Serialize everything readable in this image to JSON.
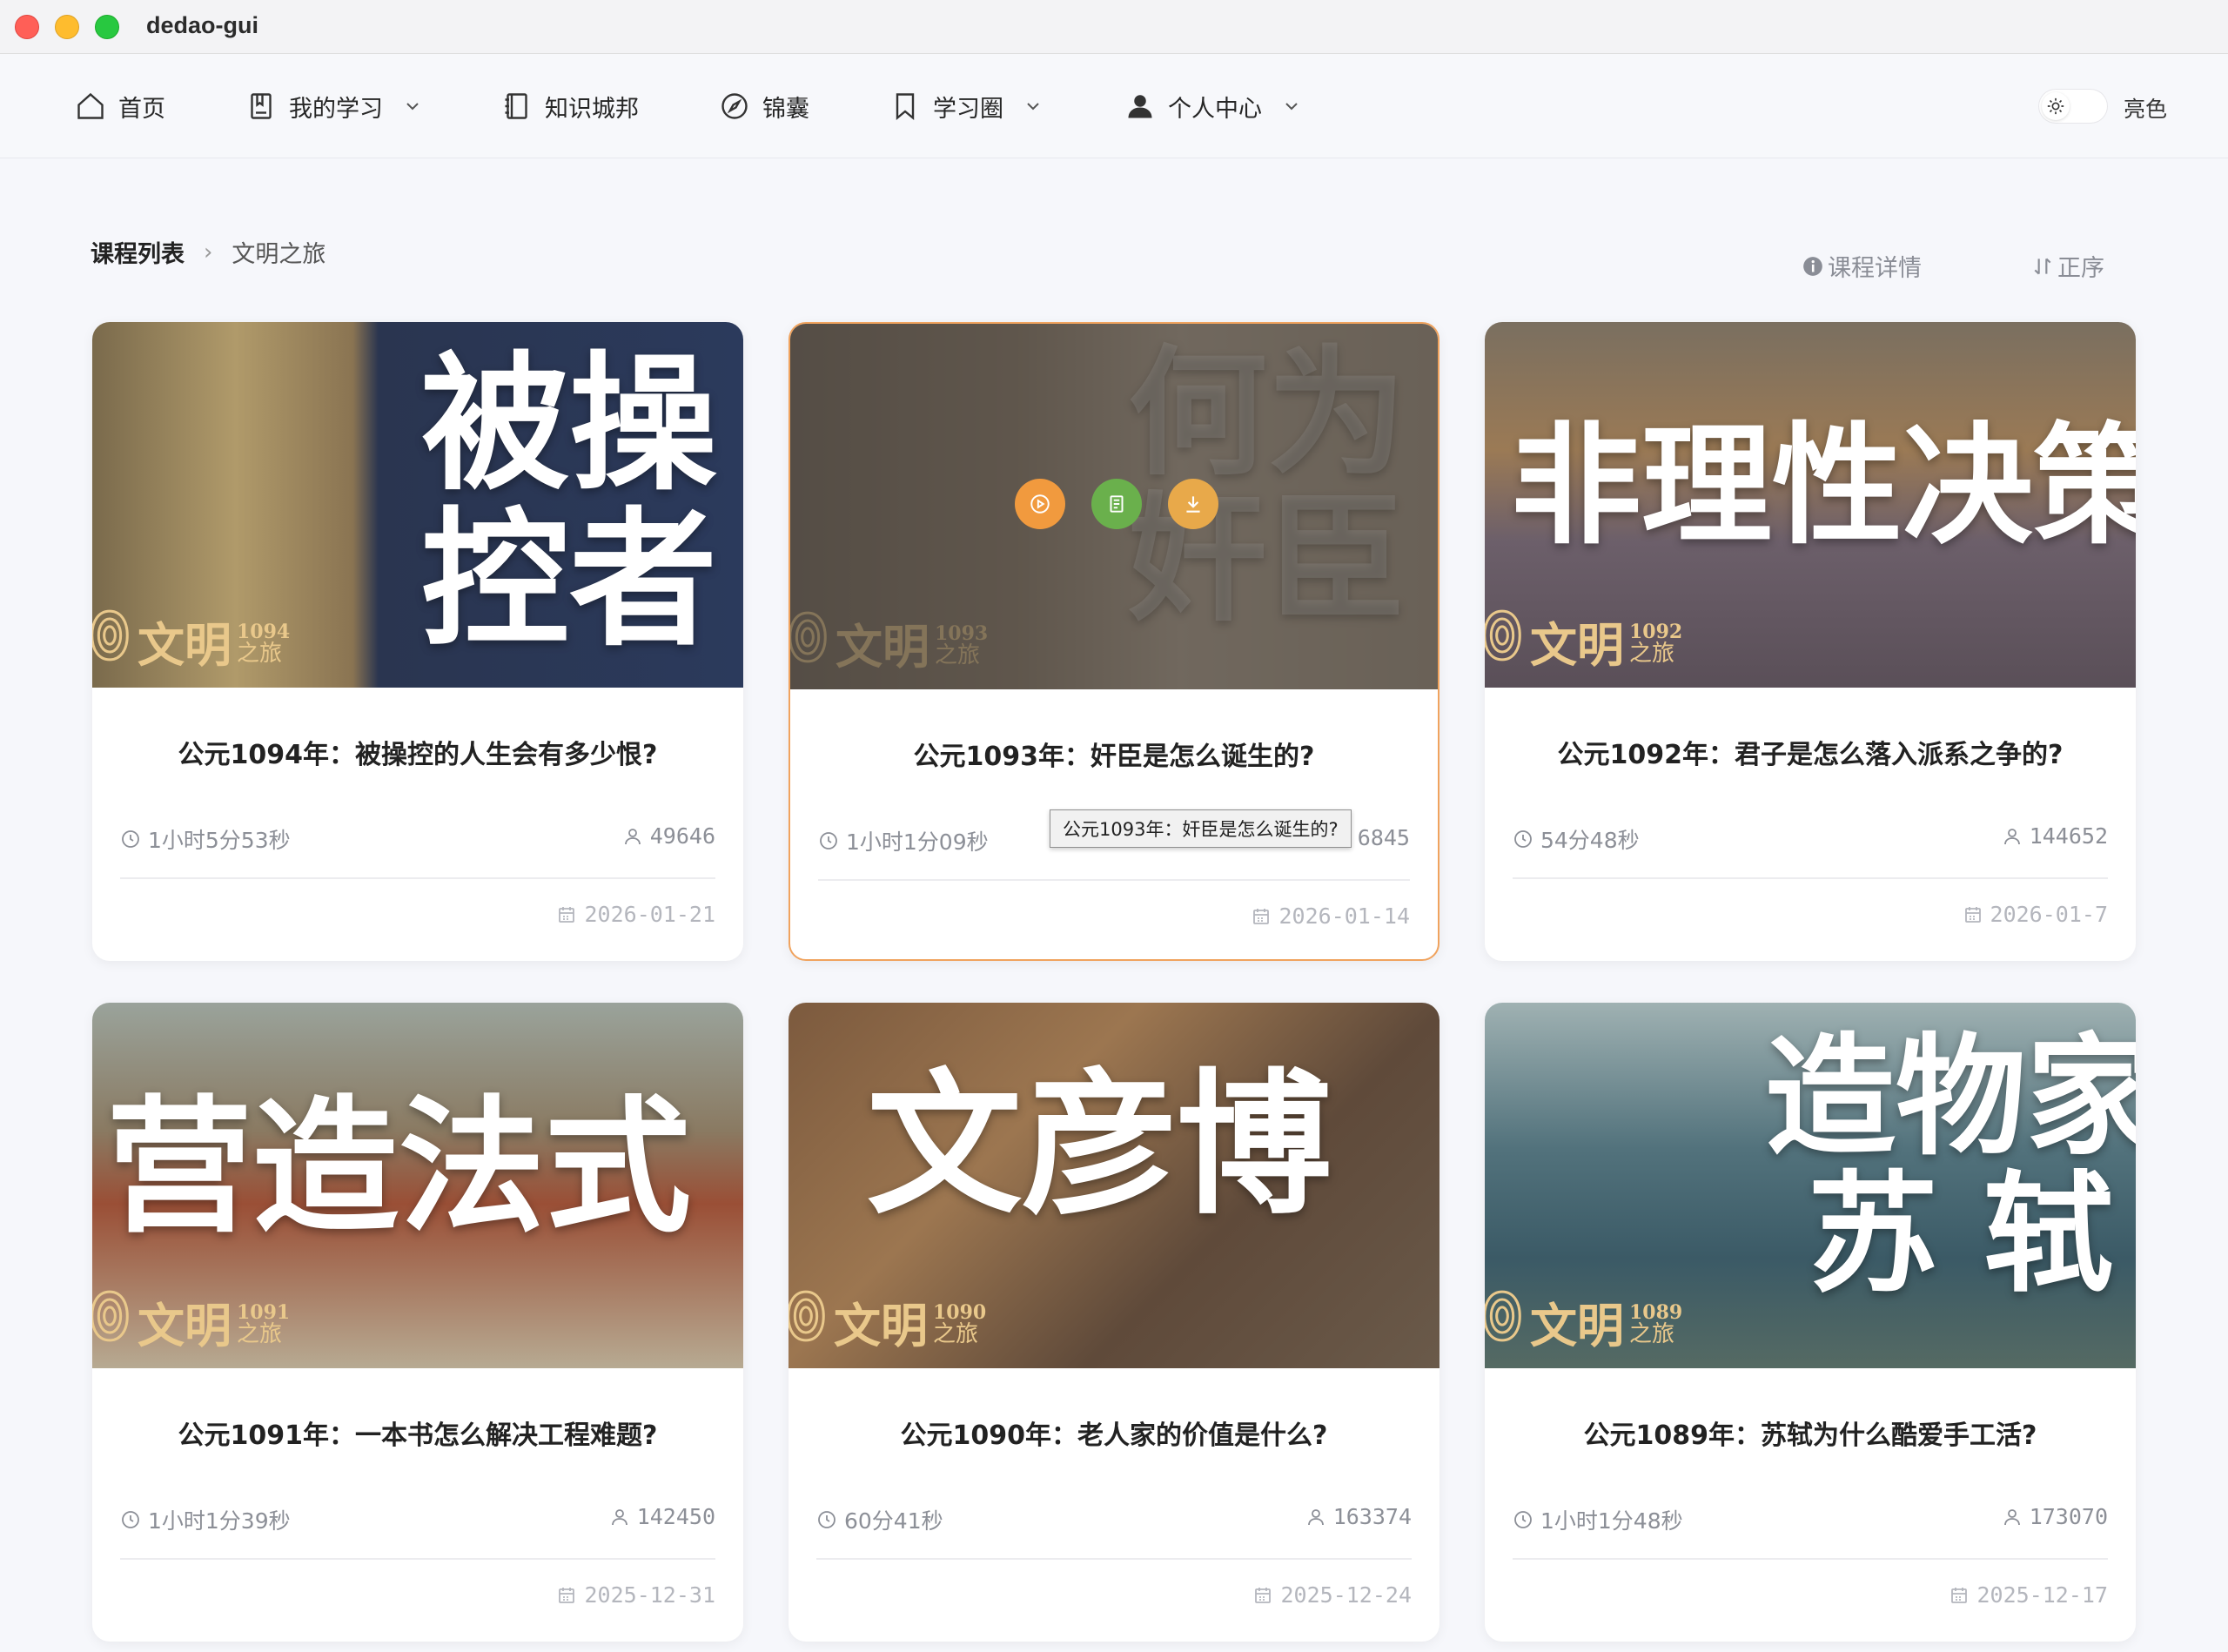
{
  "window": {
    "title": "dedao-gui"
  },
  "nav": {
    "home": "首页",
    "my_learning": "我的学习",
    "knowledge_city": "知识城邦",
    "jinnang": "锦囊",
    "learning_circle": "学习圈",
    "personal_center": "个人中心",
    "theme_label": "亮色"
  },
  "breadcrumb": {
    "root": "课程列表",
    "current": "文明之旅"
  },
  "actions": {
    "course_detail": "课程详情",
    "sort_order": "正序"
  },
  "brand": {
    "word": "文明",
    "zhi": "之旅"
  },
  "tooltip": "公元1093年：奸臣是怎么诞生的?",
  "colors": {
    "accent_orange": "#f19a3e",
    "accent_green": "#6ab04c",
    "accent_yellow": "#e8a94a",
    "active_border": "#f0a35e"
  },
  "cards": [
    {
      "title": "公元1094年：被操控的人生会有多少恨?",
      "duration": "1小时5分53秒",
      "plays": "49646",
      "date": "2026-01-21",
      "cover_text": "被操\n控者",
      "year": "1094"
    },
    {
      "title": "公元1093年：奸臣是怎么诞生的?",
      "duration": "1小时1分09秒",
      "plays": "6845",
      "date": "2026-01-14",
      "cover_text": "何为\n奸臣",
      "year": "1093"
    },
    {
      "title": "公元1092年：君子是怎么落入派系之争的?",
      "duration": "54分48秒",
      "plays": "144652",
      "date": "2026-01-7",
      "cover_text": "非理性决策",
      "year": "1092"
    },
    {
      "title": "公元1091年：一本书怎么解决工程难题?",
      "duration": "1小时1分39秒",
      "plays": "142450",
      "date": "2025-12-31",
      "cover_text": "营造法式",
      "year": "1091"
    },
    {
      "title": "公元1090年：老人家的价值是什么?",
      "duration": "60分41秒",
      "plays": "163374",
      "date": "2025-12-24",
      "cover_text": "文彦博",
      "year": "1090"
    },
    {
      "title": "公元1089年：苏轼为什么酷爱手工活?",
      "duration": "1小时1分48秒",
      "plays": "173070",
      "date": "2025-12-17",
      "cover_text": "造物家\n苏 轼",
      "year": "1089"
    }
  ]
}
